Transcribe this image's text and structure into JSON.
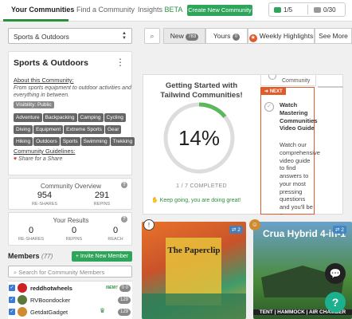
{
  "nav": {
    "tabs": [
      {
        "label": "Your Communities"
      },
      {
        "label": "Find a Community"
      },
      {
        "label": "Insights",
        "suffix": "BETA"
      }
    ],
    "create_button": "Create New Community",
    "stats": {
      "members": "1/5",
      "pins": "0/30"
    }
  },
  "toolbar": {
    "selected_community": "Sports & Outdoors",
    "filters": [
      {
        "label": "New",
        "count": "783"
      },
      {
        "label": "Yours",
        "count": "0"
      },
      {
        "label": "Weekly Highlights"
      },
      {
        "label": "See More"
      }
    ]
  },
  "about": {
    "title": "Sports & Outdoors",
    "about_link": "About this Community:",
    "description": "From sports equipment to outdoor activities and everything in between.",
    "visibility": "Visibility: Public",
    "tags": [
      "Adventure",
      "Backpacking",
      "Camping",
      "Cycling",
      "Diving",
      "Equipment",
      "Extreme Sports",
      "Gear",
      "Hiking",
      "Outdoors",
      "Sports",
      "Swimming",
      "Trekking"
    ],
    "guidelines_link": "Community Guidelines:",
    "guidelines_text": "Share for a Share"
  },
  "overview": {
    "title": "Community Overview",
    "reshares": "954",
    "reshares_label": "RE-SHARES",
    "repins": "291",
    "repins_label": "REPINS"
  },
  "results": {
    "title": "Your Results",
    "reshares": "0",
    "reshares_label": "RE-SHARES",
    "repins": "0",
    "repins_label": "REPINS",
    "reach": "0",
    "reach_label": "REACH"
  },
  "members": {
    "title": "Members",
    "count": "(77)",
    "invite_button": "+ Invite New Member",
    "search_placeholder": "Search for Community Members",
    "list": [
      {
        "name": "reddhotwheels",
        "new_label": "NEW!",
        "badge": "0 0"
      },
      {
        "name": "RVBoondocker",
        "badge": "129"
      },
      {
        "name": "GetdatGadget",
        "badge": "129"
      }
    ]
  },
  "getting_started": {
    "title": "Getting Started with Tailwind Communities!",
    "percent_text": "14%",
    "progress": 0.14,
    "completed_text": "1 / 7 COMPLETED",
    "keep_going": "Keep going, you are doing great!",
    "prev_step": "Community",
    "next_label": "NEXT",
    "next_title": "Watch Mastering Communities Video Guide",
    "next_body": "Watch our comprehensive video guide to find answers to your most pressing questions and you'll be a Communities Expert in no"
  },
  "pins": [
    {
      "title": "The Paperclip",
      "repins": "2"
    },
    {
      "title": "Crua Hybrid 4-in-1",
      "subtitle": "TENT | HAMMOCK | AIR CHAMBER",
      "repins": "2"
    }
  ],
  "colors": {
    "accent": "#2ea55a",
    "highlight": "#e05a2a",
    "progress": "#5cb85c"
  }
}
